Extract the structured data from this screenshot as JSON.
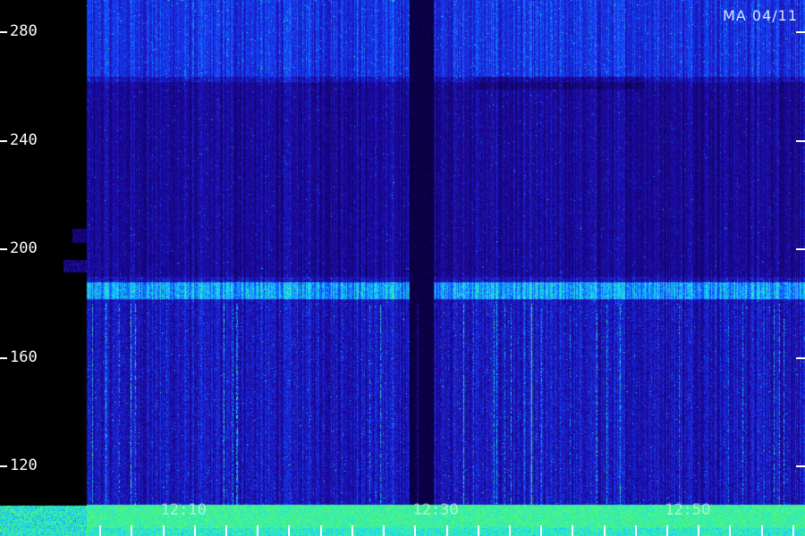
{
  "header": {
    "station_label": "MA 04/11"
  },
  "colors": {
    "background": "#000000",
    "low": "#1a0a8c",
    "mid": "#2a3cf0",
    "high": "#18d8ff",
    "peak": "#30ff60",
    "tick": "#ffffff"
  },
  "chart_data": {
    "type": "heatmap",
    "title": "",
    "xlabel": "",
    "ylabel": "",
    "y_ticks": [
      280,
      240,
      200,
      160,
      120
    ],
    "ylim": [
      106,
      292
    ],
    "x_ticks": [
      "12:10",
      "12:30",
      "12:50"
    ],
    "x_tick_times_min": [
      10,
      30,
      50
    ],
    "xlim_min": [
      2,
      59
    ],
    "dark_vertical_gap_min": [
      27.6,
      29.5
    ],
    "bright_horizontal_band_y": 186,
    "bright_band_y_range": [
      182,
      188
    ],
    "noisy_upper_band_y_range": [
      264,
      292
    ],
    "dark_band_y_range": [
      190,
      262
    ],
    "strong_signal_floor_y_range": [
      106,
      108
    ],
    "grid": false
  }
}
